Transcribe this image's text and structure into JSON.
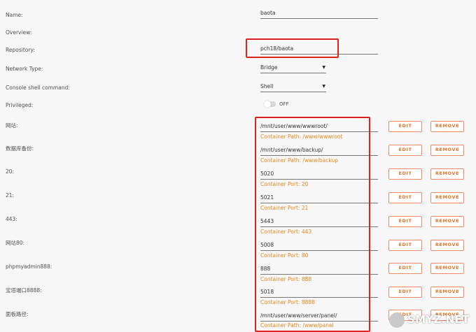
{
  "form": {
    "name": {
      "label": "Name:",
      "value": "baota"
    },
    "overview": {
      "label": "Overview:"
    },
    "repository": {
      "label": "Repository:",
      "value": "pch18/baota"
    },
    "network_type": {
      "label": "Network Type:",
      "value": "Bridge"
    },
    "console": {
      "label": "Console shell command:",
      "value": "Shell"
    },
    "privileged": {
      "label": "Privileged:",
      "state": "OFF"
    }
  },
  "mappings": [
    {
      "label": "网站:",
      "value": "/mnt/user/www/wwwroot/",
      "hint": "Container Path: /www/wwwroot"
    },
    {
      "label": "数据库备份:",
      "value": "/mnt/user/www/backup/",
      "hint": "Container Path: /www/backup"
    },
    {
      "label": "20:",
      "value": "5020",
      "hint": "Container Port: 20"
    },
    {
      "label": "21:",
      "value": "5021",
      "hint": "Container Port: 21"
    },
    {
      "label": "443:",
      "value": "5443",
      "hint": "Container Port: 443"
    },
    {
      "label": "网站80:",
      "value": "5008",
      "hint": "Container Port: 80"
    },
    {
      "label": "phpmyadmin888:",
      "value": "888",
      "hint": "Container Port: 888"
    },
    {
      "label": "宝塔端口8888:",
      "value": "5018",
      "hint": "Container Port: 8888"
    },
    {
      "label": "面板路径:",
      "value": "/mnt/user/www/server/panel/",
      "hint": "Container Path: /www/panel"
    }
  ],
  "buttons": {
    "edit": "EDIT",
    "remove": "REMOVE"
  },
  "watermark": "SMYZ.NET",
  "colors": {
    "accent": "#e2772e",
    "highlight": "#e0231e",
    "hint": "#e08a1e"
  }
}
